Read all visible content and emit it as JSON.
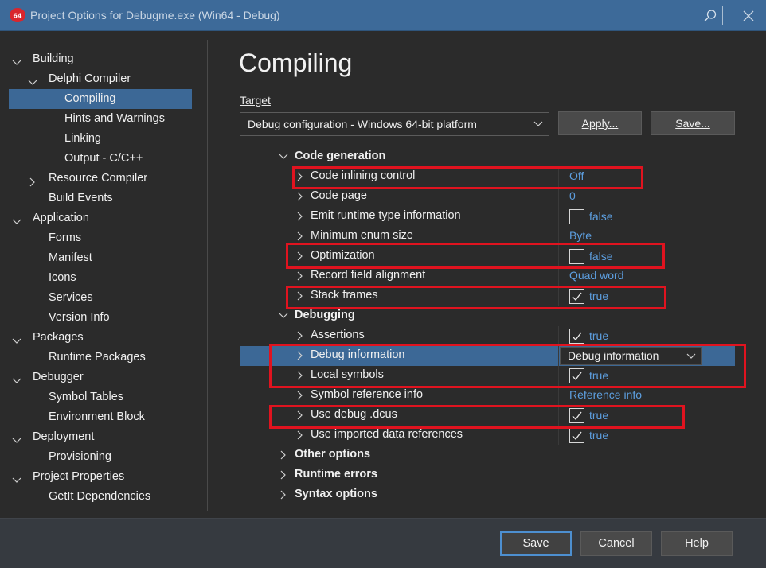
{
  "window": {
    "title": "Project Options for Debugme.exe  (Win64 - Debug)",
    "app_icon": "delphi-icon",
    "search_placeholder": "",
    "close_icon": "close-icon"
  },
  "sidebar": {
    "items": [
      {
        "label": "Building",
        "chevron": "expanded"
      },
      {
        "label": "Delphi Compiler",
        "chevron": "expanded"
      },
      {
        "label": "Compiling",
        "chevron": "none",
        "selected": true
      },
      {
        "label": "Hints and Warnings",
        "chevron": "none"
      },
      {
        "label": "Linking",
        "chevron": "none"
      },
      {
        "label": "Output - C/C++",
        "chevron": "none"
      },
      {
        "label": "Resource Compiler",
        "chevron": "collapsed"
      },
      {
        "label": "Build Events",
        "chevron": "none"
      },
      {
        "label": "Application",
        "chevron": "expanded"
      },
      {
        "label": "Forms",
        "chevron": "none"
      },
      {
        "label": "Manifest",
        "chevron": "none"
      },
      {
        "label": "Icons",
        "chevron": "none"
      },
      {
        "label": "Services",
        "chevron": "none"
      },
      {
        "label": "Version Info",
        "chevron": "none"
      },
      {
        "label": "Packages",
        "chevron": "expanded"
      },
      {
        "label": "Runtime Packages",
        "chevron": "none"
      },
      {
        "label": "Debugger",
        "chevron": "expanded"
      },
      {
        "label": "Symbol Tables",
        "chevron": "none"
      },
      {
        "label": "Environment Block",
        "chevron": "none"
      },
      {
        "label": "Deployment",
        "chevron": "expanded"
      },
      {
        "label": "Provisioning",
        "chevron": "none"
      },
      {
        "label": "Project Properties",
        "chevron": "expanded"
      },
      {
        "label": "GetIt Dependencies",
        "chevron": "none"
      }
    ]
  },
  "main": {
    "title": "Compiling",
    "target_label": "Target",
    "target_value": "Debug configuration - Windows 64-bit platform",
    "apply_label": "Apply...",
    "save_target_label": "Save..."
  },
  "grid": {
    "rows": [
      {
        "label": "Code generation",
        "section": true,
        "expanded": true
      },
      {
        "label": "Code inlining control",
        "kind": "text",
        "value": "Off",
        "highlight": true
      },
      {
        "label": "Code page",
        "kind": "text",
        "value": "0"
      },
      {
        "label": "Emit runtime type information",
        "kind": "bool",
        "checked": false,
        "value": "false"
      },
      {
        "label": "Minimum enum size",
        "kind": "text",
        "value": "Byte"
      },
      {
        "label": "Optimization",
        "kind": "bool",
        "checked": false,
        "value": "false",
        "highlight": true
      },
      {
        "label": "Record field alignment",
        "kind": "text",
        "value": "Quad word"
      },
      {
        "label": "Stack frames",
        "kind": "bool",
        "checked": true,
        "value": "true",
        "highlight": true
      },
      {
        "label": "Debugging",
        "section": true,
        "expanded": true
      },
      {
        "label": "Assertions",
        "kind": "bool",
        "checked": true,
        "value": "true"
      },
      {
        "label": "Debug information",
        "kind": "dropdown",
        "value": "Debug information",
        "selected": true,
        "highlight": true
      },
      {
        "label": "Local symbols",
        "kind": "bool",
        "checked": true,
        "value": "true",
        "highlight": true
      },
      {
        "label": "Symbol reference info",
        "kind": "text",
        "value": "Reference info"
      },
      {
        "label": "Use debug .dcus",
        "kind": "bool",
        "checked": true,
        "value": "true",
        "highlight": true
      },
      {
        "label": "Use imported data references",
        "kind": "bool",
        "checked": true,
        "value": "true"
      },
      {
        "label": "Other options",
        "section": true,
        "expanded": false
      },
      {
        "label": "Runtime errors",
        "section": true,
        "expanded": false
      },
      {
        "label": "Syntax options",
        "section": true,
        "expanded": false
      }
    ]
  },
  "footer": {
    "save_label": "Save",
    "cancel_label": "Cancel",
    "help_label": "Help"
  },
  "colors": {
    "titlebar": "#3d6a99",
    "selection": "#3c6896",
    "value_text": "#5d9fe0",
    "highlight_box": "#e0131f"
  }
}
